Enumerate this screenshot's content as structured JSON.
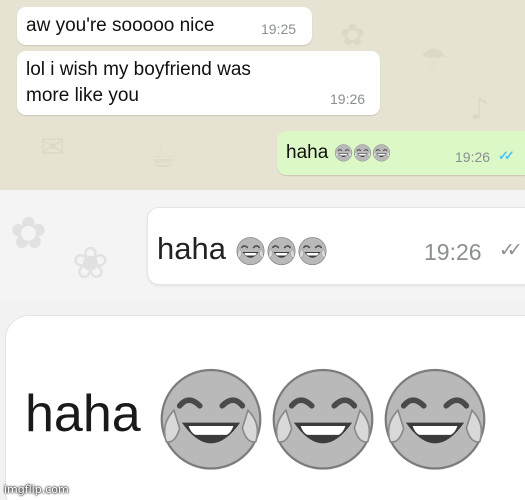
{
  "chat": {
    "messages": [
      {
        "direction": "incoming",
        "text": "aw you're sooooo nice",
        "time": "19:25"
      },
      {
        "direction": "incoming",
        "line1": "lol i wish my boyfriend was",
        "line2": "more like you",
        "time": "19:26"
      },
      {
        "direction": "outgoing",
        "text": "haha",
        "emoji_count": 3,
        "time": "19:26",
        "ticks": "✓✓",
        "status": "read"
      }
    ],
    "wallpaper_color": "#e7e3d3",
    "incoming_bubble_color": "#ffffff",
    "outgoing_bubble_color": "#dcf8c6",
    "read_tick_color": "#4fc3f7"
  },
  "zoom_medium": {
    "text": "haha",
    "emoji_count": 3,
    "time": "19:26",
    "ticks": "✓✓",
    "tick_color": "#8a8f91"
  },
  "zoom_large": {
    "text": "haha",
    "emoji_count": 3
  },
  "emoji_icon": "face-with-tears-of-joy",
  "watermark": {
    "text": "imgflip.com"
  }
}
